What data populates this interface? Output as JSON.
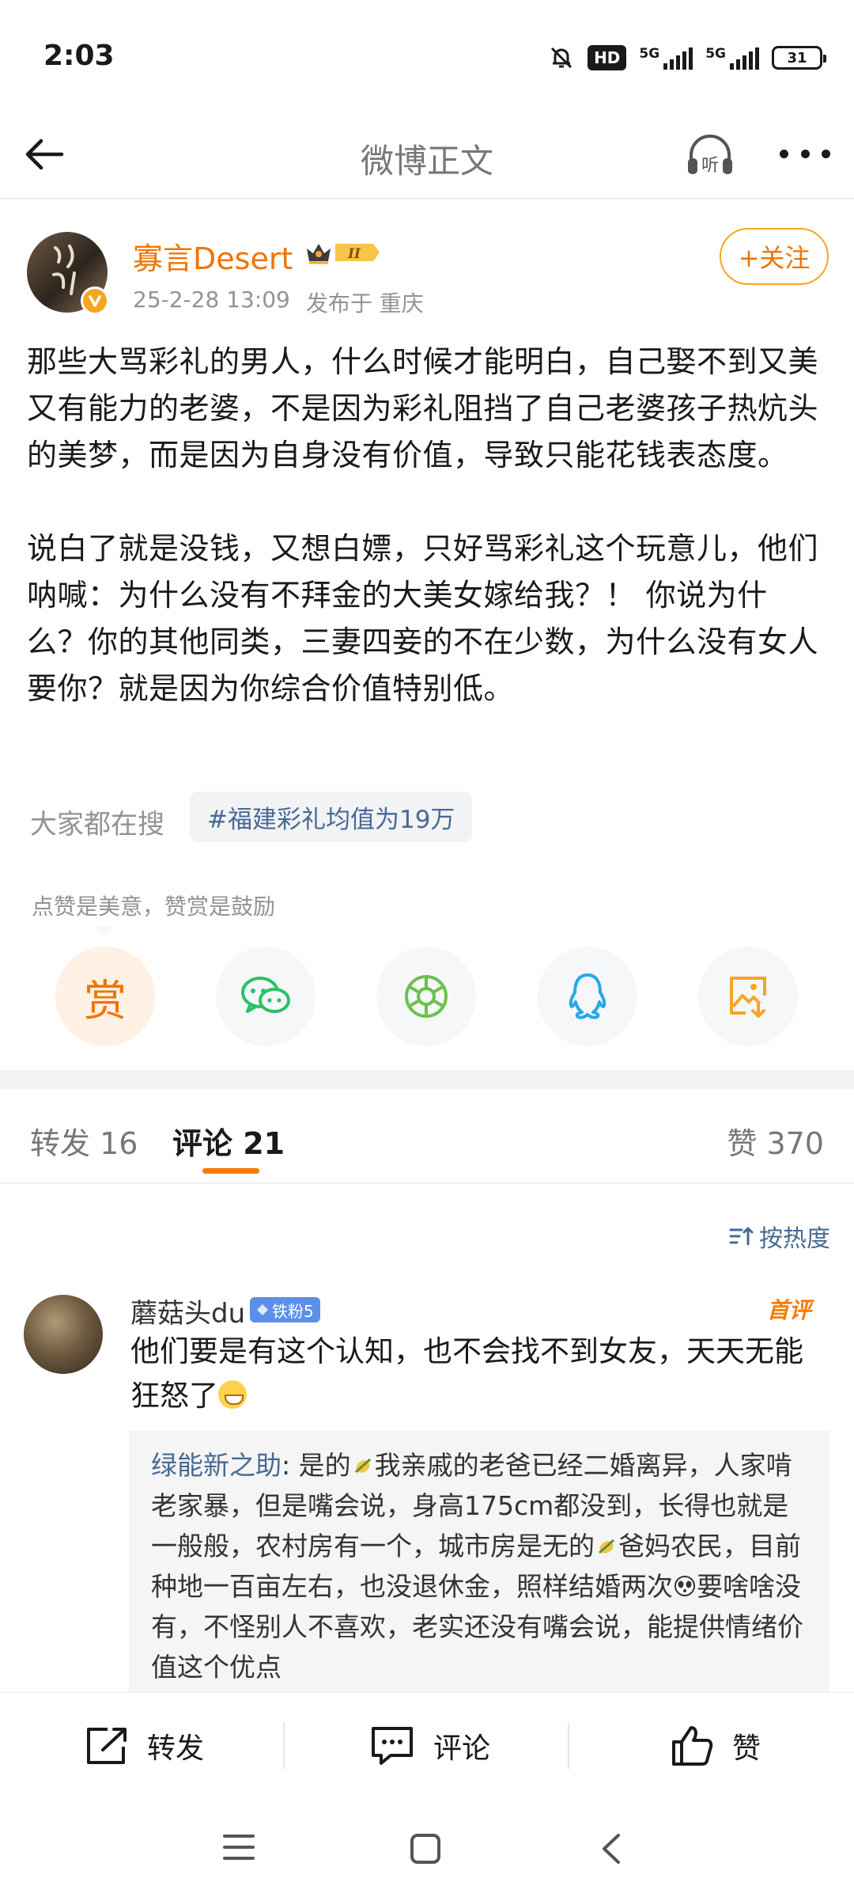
{
  "status_bar": {
    "time": "2:03",
    "hd_label": "HD",
    "signal_1": "5G",
    "signal_2": "5G",
    "battery": "31"
  },
  "nav": {
    "title": "微博正文",
    "listen_label": "听"
  },
  "post": {
    "author_name": "寡言Desert",
    "vip_level": "II",
    "date": "25-2-28 13:09",
    "location": "发布于 重庆",
    "follow_label": "+关注",
    "paragraphs": [
      "那些大骂彩礼的男人，什么时候才能明白，自己娶不到又美又有能力的老婆，不是因为彩礼阻挡了自己老婆孩子热炕头的美梦，而是因为自身没有价值，导致只能花钱表态度。",
      "说白了就是没钱，又想白嫖，只好骂彩礼这个玩意儿，他们呐喊：为什么没有不拜金的大美女嫁给我？！ 你说为什么？你的其他同类，三妻四妾的不在少数，为什么没有女人要你？就是因为你综合价值特别低。"
    ],
    "trending_label": "大家都在搜",
    "trending_topic": "#福建彩礼均值为19万",
    "reward_hint": "点赞是美意，赞赏是鼓励",
    "reward_button": "赏"
  },
  "share_targets": [
    {
      "name": "reward",
      "icon": "reward-icon"
    },
    {
      "name": "wechat",
      "icon": "wechat-icon"
    },
    {
      "name": "moments",
      "icon": "moments-icon"
    },
    {
      "name": "qq",
      "icon": "qq-icon"
    },
    {
      "name": "save-image",
      "icon": "save-image-icon"
    }
  ],
  "tabs": {
    "repost": "转发 16",
    "comments": "评论 21",
    "likes": "赞 370"
  },
  "sort_label": "按热度",
  "comment": {
    "author": "蘑菇头du",
    "fan_badge": "铁粉5",
    "first_tag": "首评",
    "text": "他们要是有这个认知，也不会找不到女友，天天无能狂怒了",
    "reply_author": "绿能新之助",
    "reply_seg1": ": 是的",
    "reply_seg2": "我亲戚的老爸已经二婚离异，人家啃老家暴，但是嘴会说，身高175cm都没到，长得也就是一般般，农村房有一个，城市房是无的",
    "reply_seg3": "爸妈农民，目前种地一百亩左右，也没退休金，照样结婚两次",
    "reply_seg4": "要啥啥没有，不怪别人不喜欢，老实还没有嘴会说，能提供情绪价值这个优点"
  },
  "toolbar": {
    "repost": "转发",
    "comment": "评论",
    "like": "赞"
  },
  "colors": {
    "accent": "#f57c00",
    "link": "#476a94",
    "muted": "#939393"
  }
}
